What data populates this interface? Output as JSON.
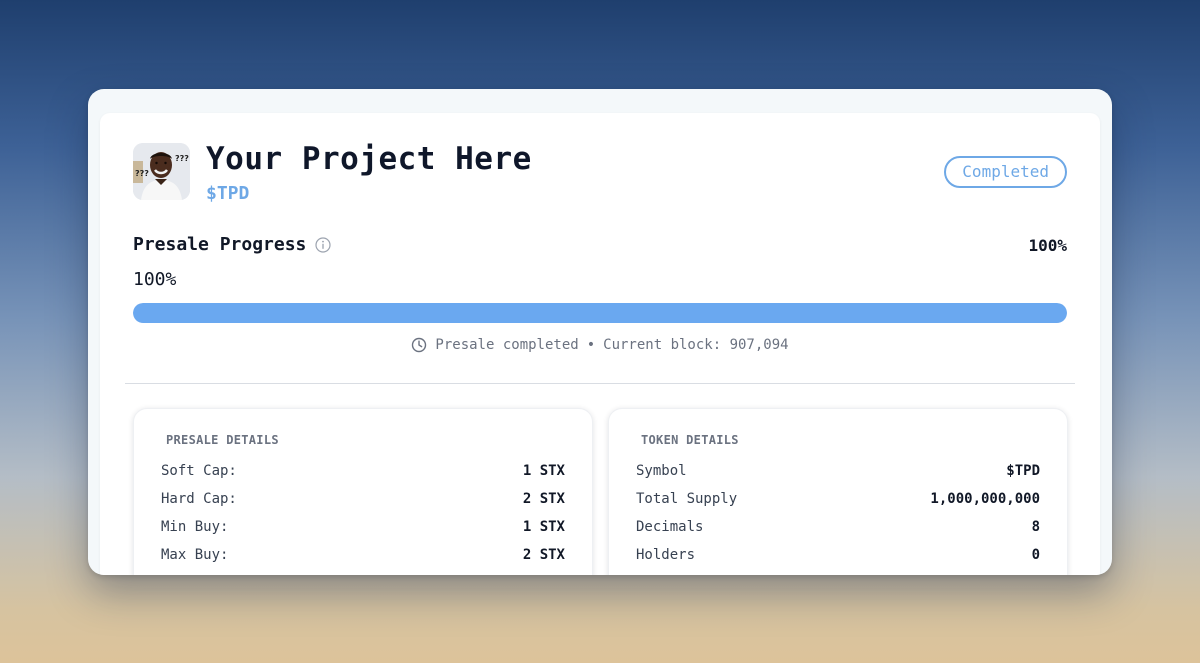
{
  "project": {
    "name": "Your Project Here",
    "ticker": "$TPD",
    "status": "Completed"
  },
  "progress": {
    "label": "Presale Progress",
    "right_value": "100%",
    "percent_text": "100%",
    "percent": 100,
    "status_text": "Presale completed",
    "separator": "•",
    "block_text": "Current block: 907,094"
  },
  "presale_details": {
    "title": "PRESALE DETAILS",
    "rows": [
      {
        "label": "Soft Cap:",
        "value": "1 STX"
      },
      {
        "label": "Hard Cap:",
        "value": "2 STX"
      },
      {
        "label": "Min Buy:",
        "value": "1 STX"
      },
      {
        "label": "Max Buy:",
        "value": "2 STX"
      }
    ]
  },
  "token_details": {
    "title": "TOKEN DETAILS",
    "rows": [
      {
        "label": "Symbol",
        "value": "$TPD"
      },
      {
        "label": "Total Supply",
        "value": "1,000,000,000"
      },
      {
        "label": "Decimals",
        "value": "8"
      },
      {
        "label": "Holders",
        "value": "0"
      }
    ]
  },
  "avatar": {
    "marks": "???"
  },
  "icons": {
    "info": "info-icon",
    "clock": "clock-icon"
  },
  "colors": {
    "accent": "#6ea8e6",
    "progress_fill": "#6aa8f0"
  }
}
